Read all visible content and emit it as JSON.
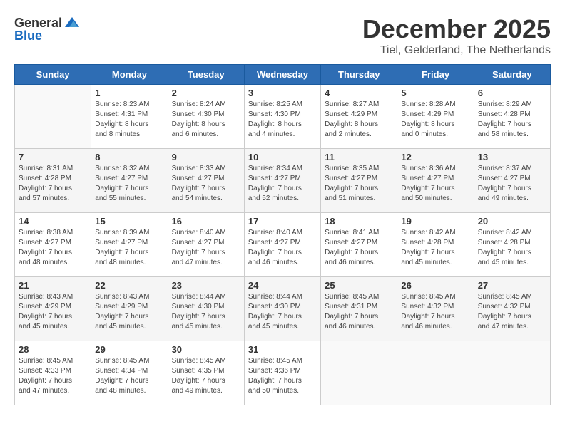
{
  "header": {
    "logo_general": "General",
    "logo_blue": "Blue",
    "month": "December 2025",
    "location": "Tiel, Gelderland, The Netherlands"
  },
  "days_of_week": [
    "Sunday",
    "Monday",
    "Tuesday",
    "Wednesday",
    "Thursday",
    "Friday",
    "Saturday"
  ],
  "weeks": [
    [
      {
        "day": "",
        "info": ""
      },
      {
        "day": "1",
        "info": "Sunrise: 8:23 AM\nSunset: 4:31 PM\nDaylight: 8 hours\nand 8 minutes."
      },
      {
        "day": "2",
        "info": "Sunrise: 8:24 AM\nSunset: 4:30 PM\nDaylight: 8 hours\nand 6 minutes."
      },
      {
        "day": "3",
        "info": "Sunrise: 8:25 AM\nSunset: 4:30 PM\nDaylight: 8 hours\nand 4 minutes."
      },
      {
        "day": "4",
        "info": "Sunrise: 8:27 AM\nSunset: 4:29 PM\nDaylight: 8 hours\nand 2 minutes."
      },
      {
        "day": "5",
        "info": "Sunrise: 8:28 AM\nSunset: 4:29 PM\nDaylight: 8 hours\nand 0 minutes."
      },
      {
        "day": "6",
        "info": "Sunrise: 8:29 AM\nSunset: 4:28 PM\nDaylight: 7 hours\nand 58 minutes."
      }
    ],
    [
      {
        "day": "7",
        "info": "Sunrise: 8:31 AM\nSunset: 4:28 PM\nDaylight: 7 hours\nand 57 minutes."
      },
      {
        "day": "8",
        "info": "Sunrise: 8:32 AM\nSunset: 4:27 PM\nDaylight: 7 hours\nand 55 minutes."
      },
      {
        "day": "9",
        "info": "Sunrise: 8:33 AM\nSunset: 4:27 PM\nDaylight: 7 hours\nand 54 minutes."
      },
      {
        "day": "10",
        "info": "Sunrise: 8:34 AM\nSunset: 4:27 PM\nDaylight: 7 hours\nand 52 minutes."
      },
      {
        "day": "11",
        "info": "Sunrise: 8:35 AM\nSunset: 4:27 PM\nDaylight: 7 hours\nand 51 minutes."
      },
      {
        "day": "12",
        "info": "Sunrise: 8:36 AM\nSunset: 4:27 PM\nDaylight: 7 hours\nand 50 minutes."
      },
      {
        "day": "13",
        "info": "Sunrise: 8:37 AM\nSunset: 4:27 PM\nDaylight: 7 hours\nand 49 minutes."
      }
    ],
    [
      {
        "day": "14",
        "info": "Sunrise: 8:38 AM\nSunset: 4:27 PM\nDaylight: 7 hours\nand 48 minutes."
      },
      {
        "day": "15",
        "info": "Sunrise: 8:39 AM\nSunset: 4:27 PM\nDaylight: 7 hours\nand 48 minutes."
      },
      {
        "day": "16",
        "info": "Sunrise: 8:40 AM\nSunset: 4:27 PM\nDaylight: 7 hours\nand 47 minutes."
      },
      {
        "day": "17",
        "info": "Sunrise: 8:40 AM\nSunset: 4:27 PM\nDaylight: 7 hours\nand 46 minutes."
      },
      {
        "day": "18",
        "info": "Sunrise: 8:41 AM\nSunset: 4:27 PM\nDaylight: 7 hours\nand 46 minutes."
      },
      {
        "day": "19",
        "info": "Sunrise: 8:42 AM\nSunset: 4:28 PM\nDaylight: 7 hours\nand 45 minutes."
      },
      {
        "day": "20",
        "info": "Sunrise: 8:42 AM\nSunset: 4:28 PM\nDaylight: 7 hours\nand 45 minutes."
      }
    ],
    [
      {
        "day": "21",
        "info": "Sunrise: 8:43 AM\nSunset: 4:29 PM\nDaylight: 7 hours\nand 45 minutes."
      },
      {
        "day": "22",
        "info": "Sunrise: 8:43 AM\nSunset: 4:29 PM\nDaylight: 7 hours\nand 45 minutes."
      },
      {
        "day": "23",
        "info": "Sunrise: 8:44 AM\nSunset: 4:30 PM\nDaylight: 7 hours\nand 45 minutes."
      },
      {
        "day": "24",
        "info": "Sunrise: 8:44 AM\nSunset: 4:30 PM\nDaylight: 7 hours\nand 45 minutes."
      },
      {
        "day": "25",
        "info": "Sunrise: 8:45 AM\nSunset: 4:31 PM\nDaylight: 7 hours\nand 46 minutes."
      },
      {
        "day": "26",
        "info": "Sunrise: 8:45 AM\nSunset: 4:32 PM\nDaylight: 7 hours\nand 46 minutes."
      },
      {
        "day": "27",
        "info": "Sunrise: 8:45 AM\nSunset: 4:32 PM\nDaylight: 7 hours\nand 47 minutes."
      }
    ],
    [
      {
        "day": "28",
        "info": "Sunrise: 8:45 AM\nSunset: 4:33 PM\nDaylight: 7 hours\nand 47 minutes."
      },
      {
        "day": "29",
        "info": "Sunrise: 8:45 AM\nSunset: 4:34 PM\nDaylight: 7 hours\nand 48 minutes."
      },
      {
        "day": "30",
        "info": "Sunrise: 8:45 AM\nSunset: 4:35 PM\nDaylight: 7 hours\nand 49 minutes."
      },
      {
        "day": "31",
        "info": "Sunrise: 8:45 AM\nSunset: 4:36 PM\nDaylight: 7 hours\nand 50 minutes."
      },
      {
        "day": "",
        "info": ""
      },
      {
        "day": "",
        "info": ""
      },
      {
        "day": "",
        "info": ""
      }
    ]
  ]
}
